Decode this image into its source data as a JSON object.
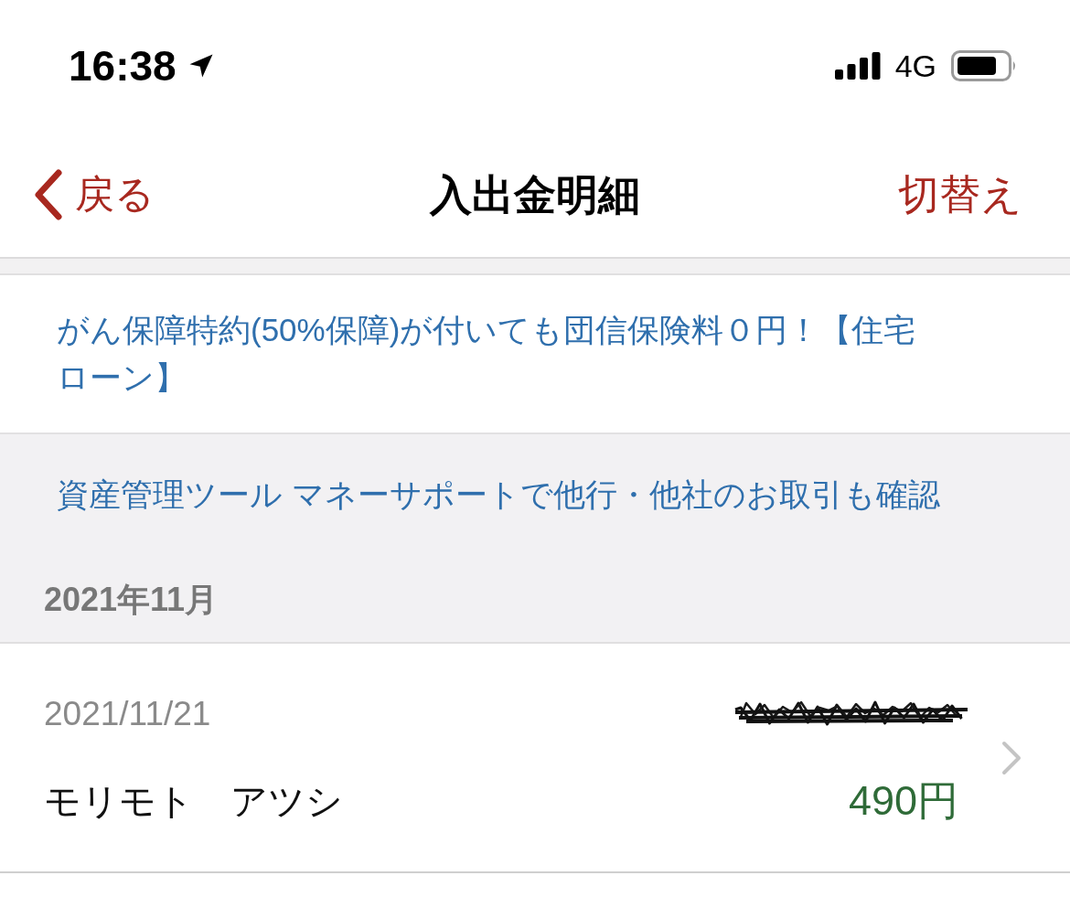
{
  "status_bar": {
    "time": "16:38",
    "network": "4G"
  },
  "nav_bar": {
    "back_label": "戻る",
    "title": "入出金明細",
    "action_label": "切替え"
  },
  "banners": [
    {
      "kind": "ad",
      "text": "がん保障特約(50%保障)が付いても団信保険料０円！【住宅ローン】"
    },
    {
      "kind": "tool",
      "text": "資産管理ツール マネーサポートで他行・他社のお取引も確認"
    }
  ],
  "transaction_groups": [
    {
      "month": "2021年11月",
      "transactions": [
        {
          "date": "2021/11/21",
          "name": "モリモト　アツシ",
          "amount": "490円",
          "deposit": true
        }
      ]
    }
  ]
}
